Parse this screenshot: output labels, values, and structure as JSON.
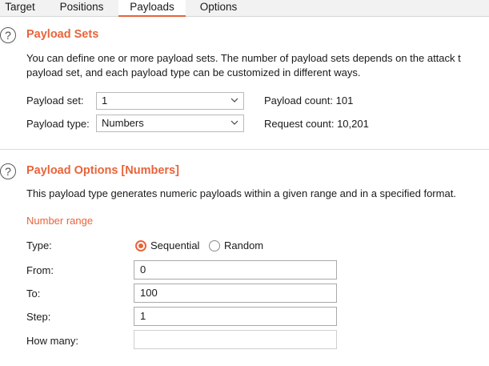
{
  "tabs": [
    {
      "label": "Target"
    },
    {
      "label": "Positions"
    },
    {
      "label": "Payloads"
    },
    {
      "label": "Options"
    }
  ],
  "payload_sets": {
    "title": "Payload Sets",
    "description_line1": "You can define one or more payload sets. The number of payload sets depends on the attack t",
    "description_line2": "payload set, and each payload type can be customized in different ways.",
    "payload_set_label": "Payload set:",
    "payload_set_value": "1",
    "payload_type_label": "Payload type:",
    "payload_type_value": "Numbers",
    "payload_count_label": "Payload count:",
    "payload_count_value": "101",
    "request_count_label": "Request count:",
    "request_count_value": "10,201"
  },
  "payload_options": {
    "title": "Payload Options [Numbers]",
    "description": "This payload type generates numeric payloads within a given range and in a specified format.",
    "number_range_heading": "Number range",
    "type_label": "Type:",
    "type_options": [
      "Sequential",
      "Random"
    ],
    "type_selected": "Sequential",
    "from_label": "From:",
    "from_value": "0",
    "to_label": "To:",
    "to_value": "100",
    "step_label": "Step:",
    "step_value": "1",
    "how_many_label": "How many:",
    "how_many_value": ""
  },
  "colors": {
    "accent": "#e8643a"
  }
}
